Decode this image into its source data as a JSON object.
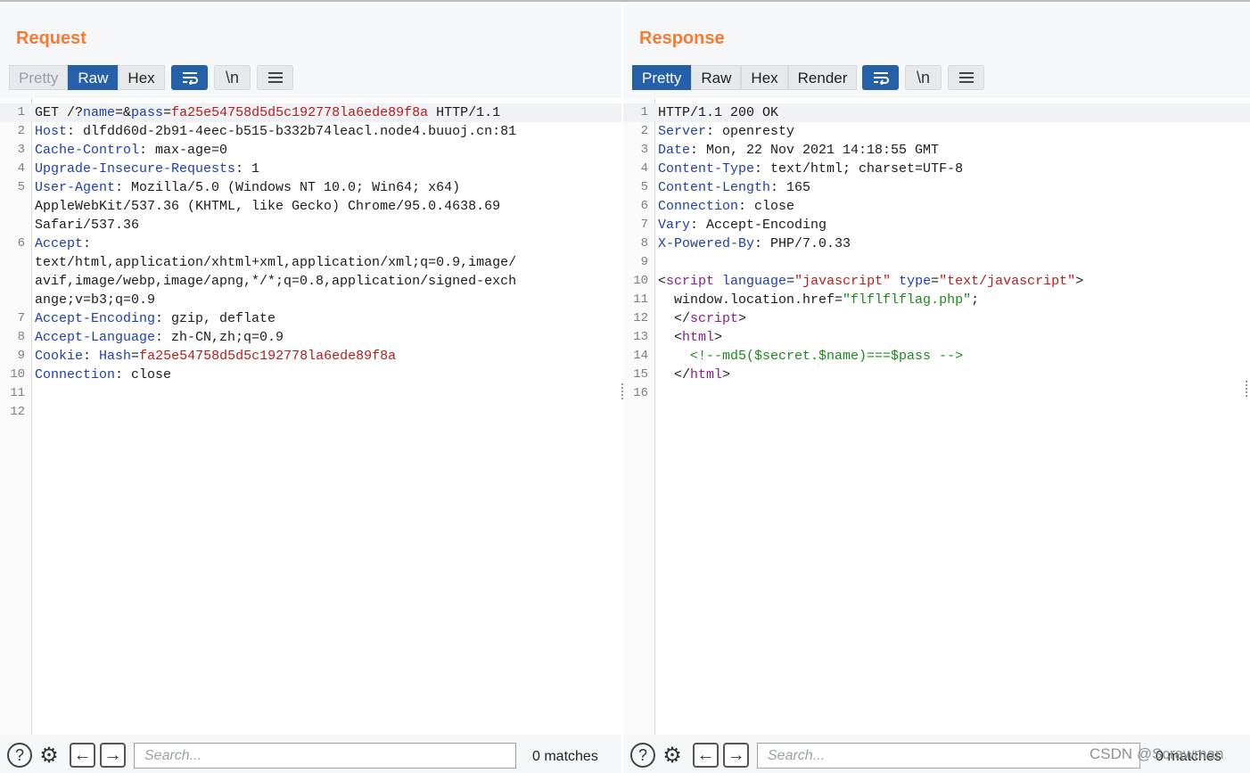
{
  "request": {
    "title": "Request",
    "tabs": [
      "Pretty",
      "Raw",
      "Hex"
    ],
    "active_tab": "Raw",
    "disabled_tab": "Pretty",
    "tool_icons": [
      "wrap-icon",
      "newline-icon",
      "menu-icon"
    ],
    "newline_label": "\\n",
    "lines": [
      [
        {
          "t": "GET /?",
          "c": ""
        },
        {
          "t": "name",
          "c": "k"
        },
        {
          "t": "=&",
          "c": ""
        },
        {
          "t": "pass",
          "c": "k"
        },
        {
          "t": "=",
          "c": ""
        },
        {
          "t": "fa25e54758d5d5c192778la6ede89f8a",
          "c": "v"
        },
        {
          "t": " HTTP/1.1",
          "c": ""
        }
      ],
      [
        {
          "t": "Host",
          "c": "k"
        },
        {
          "t": ": dlfdd60d-2b91-4eec-b515-b332b74leacl.node4.buuoj.cn:81",
          "c": ""
        }
      ],
      [
        {
          "t": "Cache-Control",
          "c": "k"
        },
        {
          "t": ": max-age=0",
          "c": ""
        }
      ],
      [
        {
          "t": "Upgrade-Insecure-Requests",
          "c": "k"
        },
        {
          "t": ": 1",
          "c": ""
        }
      ],
      [
        {
          "t": "User-Agent",
          "c": "k"
        },
        {
          "t": ": Mozilla/5.0 (Windows NT 10.0; Win64; x64)",
          "c": ""
        }
      ],
      [
        {
          "t": "AppleWebKit/537.36 (KHTML, like Gecko) Chrome/95.0.4638.69",
          "c": ""
        }
      ],
      [
        {
          "t": "Safari/537.36",
          "c": ""
        }
      ],
      [
        {
          "t": "Accept",
          "c": "k"
        },
        {
          "t": ":",
          "c": ""
        }
      ],
      [
        {
          "t": "text/html,application/xhtml+xml,application/xml;q=0.9,image/",
          "c": ""
        }
      ],
      [
        {
          "t": "avif,image/webp,image/apng,*/*;q=0.8,application/signed-exch",
          "c": ""
        }
      ],
      [
        {
          "t": "ange;v=b3;q=0.9",
          "c": ""
        }
      ],
      [
        {
          "t": "Accept-Encoding",
          "c": "k"
        },
        {
          "t": ": gzip, deflate",
          "c": ""
        }
      ],
      [
        {
          "t": "Accept-Language",
          "c": "k"
        },
        {
          "t": ": zh-CN,zh;q=0.9",
          "c": ""
        }
      ],
      [
        {
          "t": "Cookie",
          "c": "k"
        },
        {
          "t": ": ",
          "c": ""
        },
        {
          "t": "Hash",
          "c": "k"
        },
        {
          "t": "=",
          "c": ""
        },
        {
          "t": "fa25e54758d5d5c192778la6ede89f8a",
          "c": "v"
        }
      ],
      [
        {
          "t": "Connection",
          "c": "k"
        },
        {
          "t": ": close",
          "c": ""
        }
      ],
      [],
      []
    ],
    "line_numbers": [
      "1",
      "2",
      "3",
      "4",
      "5",
      "",
      "",
      "6",
      "",
      "",
      "",
      "7",
      "8",
      "9",
      "10",
      "11",
      "12"
    ],
    "search_placeholder": "Search...",
    "matches": "0 matches"
  },
  "response": {
    "title": "Response",
    "tabs": [
      "Pretty",
      "Raw",
      "Hex",
      "Render"
    ],
    "active_tab": "Pretty",
    "tool_icons": [
      "wrap-icon",
      "newline-icon",
      "menu-icon"
    ],
    "newline_label": "\\n",
    "lines": [
      [
        {
          "t": "HTTP/1.1 200 OK",
          "c": ""
        }
      ],
      [
        {
          "t": "Server",
          "c": "k"
        },
        {
          "t": ": openresty",
          "c": ""
        }
      ],
      [
        {
          "t": "Date",
          "c": "k"
        },
        {
          "t": ": Mon, 22 Nov 2021 14:18:55 GMT",
          "c": ""
        }
      ],
      [
        {
          "t": "Content-Type",
          "c": "k"
        },
        {
          "t": ": text/html; charset=UTF-8",
          "c": ""
        }
      ],
      [
        {
          "t": "Content-Length",
          "c": "k"
        },
        {
          "t": ": 165",
          "c": ""
        }
      ],
      [
        {
          "t": "Connection",
          "c": "k"
        },
        {
          "t": ": close",
          "c": ""
        }
      ],
      [
        {
          "t": "Vary",
          "c": "k"
        },
        {
          "t": ": Accept-Encoding",
          "c": ""
        }
      ],
      [
        {
          "t": "X-Powered-By",
          "c": "k"
        },
        {
          "t": ": PHP/7.0.33",
          "c": ""
        }
      ],
      [],
      [
        {
          "t": "<",
          "c": ""
        },
        {
          "t": "script",
          "c": "tag"
        },
        {
          "t": " ",
          "c": ""
        },
        {
          "t": "language",
          "c": "attr"
        },
        {
          "t": "=",
          "c": ""
        },
        {
          "t": "\"javascript\"",
          "c": "v"
        },
        {
          "t": " ",
          "c": ""
        },
        {
          "t": "type",
          "c": "attr"
        },
        {
          "t": "=",
          "c": ""
        },
        {
          "t": "\"text/javascript\"",
          "c": "v"
        },
        {
          "t": ">",
          "c": ""
        }
      ],
      [
        {
          "t": "  window.location.href=",
          "c": ""
        },
        {
          "t": "\"flflflflag.php\"",
          "c": "str"
        },
        {
          "t": ";",
          "c": ""
        }
      ],
      [
        {
          "t": "  </",
          "c": ""
        },
        {
          "t": "script",
          "c": "tag"
        },
        {
          "t": ">",
          "c": ""
        }
      ],
      [
        {
          "t": "  <",
          "c": ""
        },
        {
          "t": "html",
          "c": "tag"
        },
        {
          "t": ">",
          "c": ""
        }
      ],
      [
        {
          "t": "    ",
          "c": ""
        },
        {
          "t": "<!--md5($secret.$name)===$pass -->",
          "c": "cmt"
        }
      ],
      [
        {
          "t": "  </",
          "c": ""
        },
        {
          "t": "html",
          "c": "tag"
        },
        {
          "t": ">",
          "c": ""
        }
      ],
      []
    ],
    "line_numbers": [
      "1",
      "2",
      "3",
      "4",
      "5",
      "6",
      "7",
      "8",
      "9",
      "10",
      "11",
      "12",
      "13",
      "14",
      "15",
      "16"
    ],
    "search_placeholder": "Search...",
    "matches": "0 matches"
  },
  "watermark": "CSDN @Scrawman",
  "colors": {
    "accent": "#2660a8",
    "title": "#f47b31",
    "key": "#1c3fae",
    "value": "#b71c1c"
  }
}
